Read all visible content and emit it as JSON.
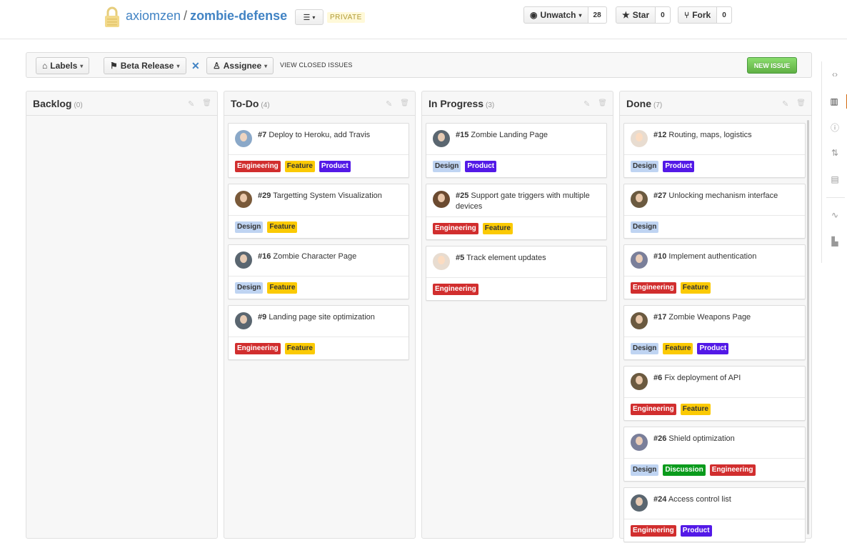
{
  "repo": {
    "owner": "axiomzen",
    "separator": "/",
    "name": "zombie-defense",
    "privacy": "PRIVATE",
    "menu_icon": "list-icon"
  },
  "actions": {
    "unwatch": {
      "label": "Unwatch",
      "count": "28"
    },
    "star": {
      "label": "Star",
      "count": "0"
    },
    "fork": {
      "label": "Fork",
      "count": "0"
    }
  },
  "filters": {
    "labels": "Labels",
    "milestone": "Beta Release",
    "assignee": "Assignee",
    "closed_link": "VIEW CLOSED ISSUES",
    "new_issue": "NEW ISSUE"
  },
  "colors": {
    "Engineering": "#d12e2e",
    "Feature": "#fbca04",
    "Product": "#5319e7",
    "Design": "#bfd4f2",
    "Discussion": "#0a9b1c",
    "accent": "#4183c4"
  },
  "columns": [
    {
      "title": "Backlog",
      "count": "(0)",
      "cards": []
    },
    {
      "title": "To-Do",
      "count": "(4)",
      "cards": [
        {
          "num": "#7",
          "title": "Deploy to Heroku, add Travis",
          "avatar": "#8aa8c8",
          "labels": [
            "Engineering",
            "Feature",
            "Product"
          ]
        },
        {
          "num": "#29",
          "title": "Targetting System Visualization",
          "avatar": "#7a5a3a",
          "labels": [
            "Design",
            "Feature"
          ]
        },
        {
          "num": "#16",
          "title": "Zombie Character Page",
          "avatar": "#5a6670",
          "labels": [
            "Design",
            "Feature"
          ]
        },
        {
          "num": "#9",
          "title": "Landing page site optimization",
          "avatar": "#5a6670",
          "labels": [
            "Engineering",
            "Feature"
          ]
        }
      ]
    },
    {
      "title": "In Progress",
      "count": "(3)",
      "cards": [
        {
          "num": "#15",
          "title": "Zombie Landing Page",
          "avatar": "#5a6670",
          "labels": [
            "Design",
            "Product"
          ]
        },
        {
          "num": "#25",
          "title": "Support gate triggers with multiple devices",
          "avatar": "#6b4a30",
          "labels": [
            "Engineering",
            "Feature"
          ]
        },
        {
          "num": "#5",
          "title": "Track element updates",
          "avatar": "#e8dcd0",
          "labels": [
            "Engineering"
          ]
        }
      ]
    },
    {
      "title": "Done",
      "count": "(7)",
      "cards": [
        {
          "num": "#12",
          "title": "Routing, maps, logistics",
          "avatar": "#e8dcd0",
          "labels": [
            "Design",
            "Product"
          ]
        },
        {
          "num": "#27",
          "title": "Unlocking mechanism interface",
          "avatar": "#6b5a40",
          "labels": [
            "Design"
          ]
        },
        {
          "num": "#10",
          "title": "Implement authentication",
          "avatar": "#7a7f9a",
          "labels": [
            "Engineering",
            "Feature"
          ]
        },
        {
          "num": "#17",
          "title": "Zombie Weapons Page",
          "avatar": "#6b5a40",
          "labels": [
            "Design",
            "Feature",
            "Product"
          ]
        },
        {
          "num": "#6",
          "title": "Fix deployment of API",
          "avatar": "#6b5a40",
          "labels": [
            "Engineering",
            "Feature"
          ]
        },
        {
          "num": "#26",
          "title": "Shield optimization",
          "avatar": "#7a7f9a",
          "labels": [
            "Design",
            "Discussion",
            "Engineering"
          ]
        },
        {
          "num": "#24",
          "title": "Access control list",
          "avatar": "#5a6670",
          "labels": [
            "Engineering",
            "Product"
          ]
        }
      ]
    }
  ],
  "side_nav": [
    "code-icon",
    "board-icon",
    "issues-icon",
    "pull-requests-icon",
    "wiki-icon",
    "pulse-icon",
    "graphs-icon"
  ]
}
